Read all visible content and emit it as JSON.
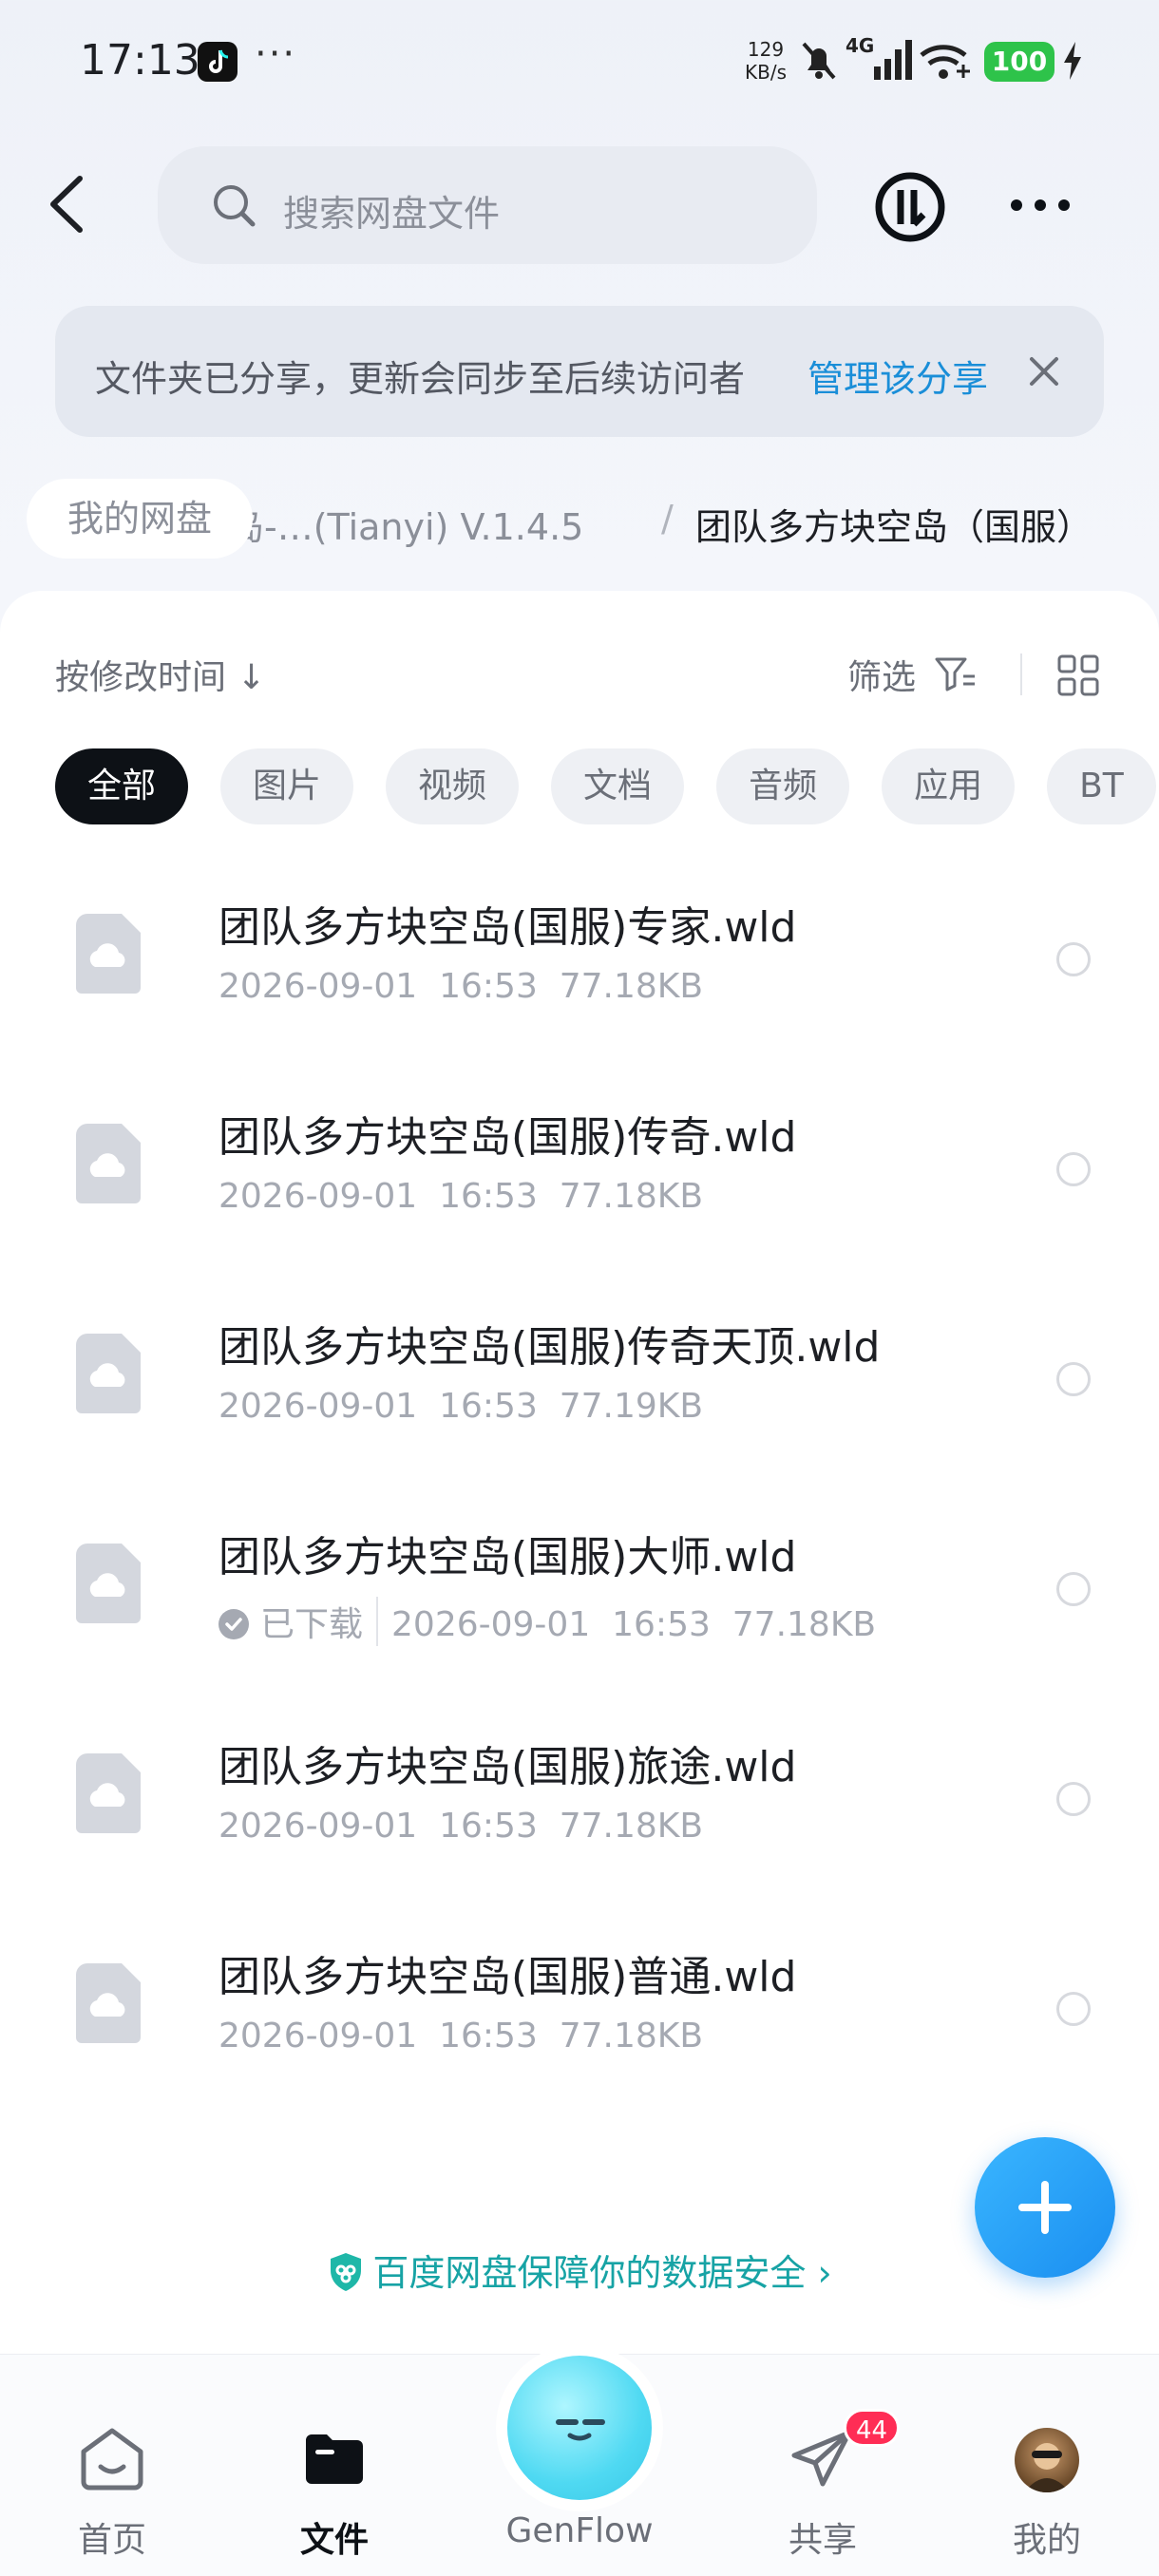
{
  "status_bar": {
    "time": "17:13",
    "dots": "···",
    "speed_value": "129",
    "speed_unit": "KB/s",
    "network": "4G",
    "battery": "100"
  },
  "header": {
    "search_placeholder": "搜索网盘文件"
  },
  "share_banner": {
    "text": "文件夹已分享，更新会同步至后续访问者",
    "manage": "管理该分享"
  },
  "breadcrumb": {
    "home": "我的网盘",
    "middle": "岛-…(Tianyi) V.1.4.5",
    "separator": "/",
    "current": "团队多方块空岛（国服）"
  },
  "toolbar": {
    "sort": "按修改时间 ↓",
    "filter": "筛选"
  },
  "chips": [
    "全部",
    "图片",
    "视频",
    "文档",
    "音频",
    "应用",
    "BT"
  ],
  "files": [
    {
      "name": "团队多方块空岛(国服)专家.wld",
      "date": "2026-09-01",
      "time": "16:53",
      "size": "77.18KB"
    },
    {
      "name": "团队多方块空岛(国服)传奇.wld",
      "date": "2026-09-01",
      "time": "16:53",
      "size": "77.18KB"
    },
    {
      "name": "团队多方块空岛(国服)传奇天顶.wld",
      "date": "2026-09-01",
      "time": "16:53",
      "size": "77.19KB"
    },
    {
      "name": "团队多方块空岛(国服)大师.wld",
      "downloaded": "已下载",
      "date": "2026-09-01",
      "time": "16:53",
      "size": "77.18KB"
    },
    {
      "name": "团队多方块空岛(国服)旅途.wld",
      "date": "2026-09-01",
      "time": "16:53",
      "size": "77.18KB"
    },
    {
      "name": "团队多方块空岛(国服)普通.wld",
      "date": "2026-09-01",
      "time": "16:53",
      "size": "77.18KB"
    }
  ],
  "safety": {
    "text": "百度网盘保障你的数据安全",
    "chevron": "›"
  },
  "bottom_nav": {
    "home": "首页",
    "files": "文件",
    "genflow": "GenFlow",
    "share": "共享",
    "share_badge": "44",
    "me": "我的"
  },
  "colors": {
    "accent": "#1a8ed8",
    "safety_teal": "#17a3a5",
    "badge_red": "#ff2d55",
    "battery_green": "#2ec34a"
  },
  "icons": [
    "back-arrow-icon",
    "search-icon",
    "history-icon",
    "more-icon",
    "close-icon",
    "filter-icon",
    "grid-view-icon",
    "cloud-file-icon",
    "check-icon",
    "plus-icon",
    "shield-icon",
    "home-icon",
    "folder-icon",
    "send-icon"
  ]
}
